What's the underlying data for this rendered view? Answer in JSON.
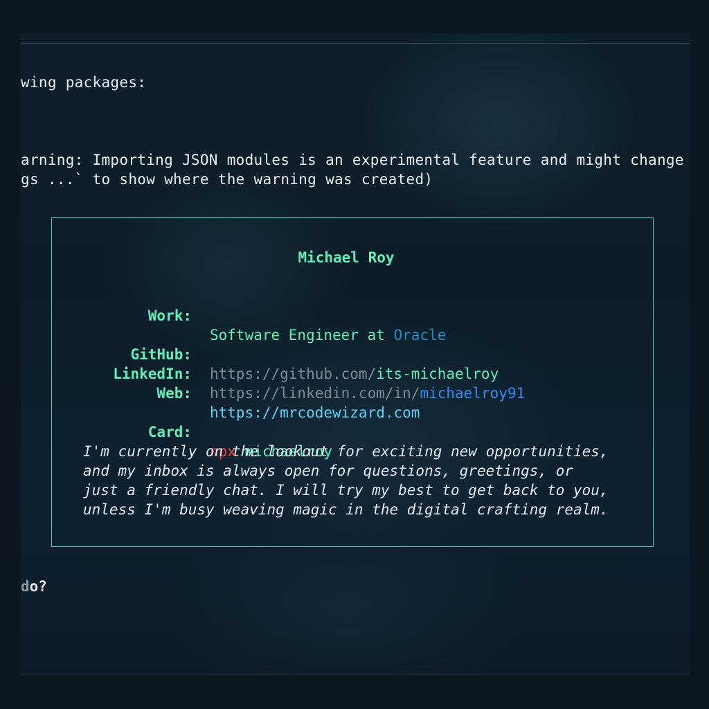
{
  "terminal": {
    "line_packages": "wing packages:",
    "line_warning_1": "arning: Importing JSON modules is an experimental feature and might change",
    "line_warning_2": "gs ...` to show where the warning was created)",
    "prompt_dim": "d",
    "prompt_rest": "o?"
  },
  "card": {
    "name": "Michael Roy",
    "work": {
      "label": "Work:",
      "role": "Software Engineer at ",
      "company": "Oracle"
    },
    "github": {
      "label": "GitHub:",
      "prefix": "https://github.com/",
      "handle": "its-michaelroy"
    },
    "linkedin": {
      "label": "LinkedIn:",
      "prefix": "https://linkedin.com/in/",
      "handle": "michaelroy91"
    },
    "web": {
      "label": "Web:",
      "url": "https://mrcodewizard.com"
    },
    "npx_card": {
      "label": "Card:",
      "command": "npx",
      "package": " michaelroy"
    },
    "bio": [
      "I'm currently on the lookout for exciting new opportunities,",
      "and my inbox is always open for questions, greetings, or",
      "just a friendly chat. I will try my best to get back to you,",
      "unless I'm busy weaving magic in the digital crafting realm."
    ]
  },
  "colors": {
    "accent_green": "#5ef0b8",
    "company_blue": "#1e8ec4",
    "link_gray": "#7d8b93",
    "linkedin_blue": "#2e8cf2",
    "web_cyan": "#5ad5f4",
    "npx_red": "#f0463c",
    "border": "#4fd1b0"
  }
}
